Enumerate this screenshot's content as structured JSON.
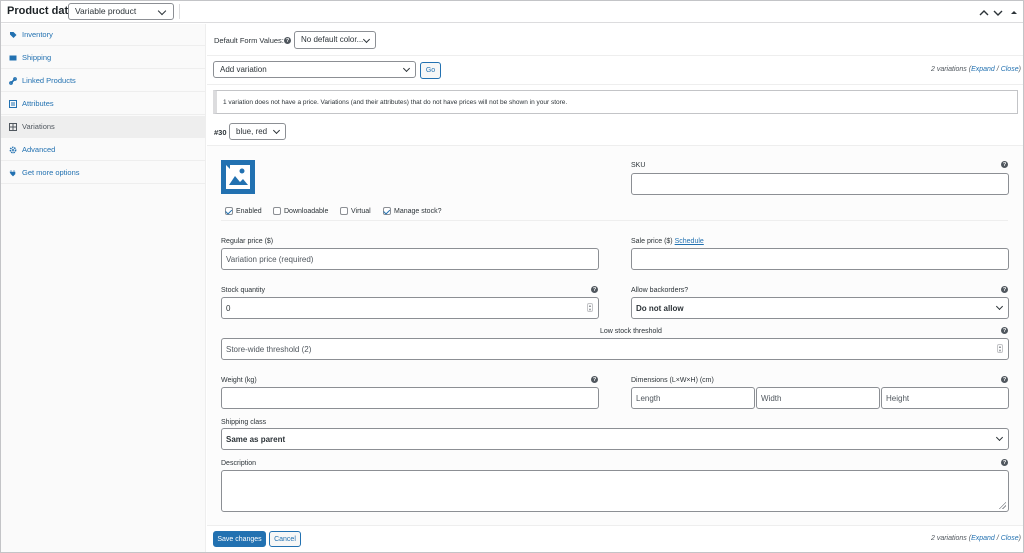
{
  "header": {
    "title": "Product data —",
    "product_type": "Variable product",
    "icons": [
      "chevron-up-icon",
      "chevron-down-icon",
      "collapse-toggle-icon"
    ]
  },
  "sidebar": {
    "items": [
      {
        "label": "Inventory",
        "icon": "inventory-tag-icon"
      },
      {
        "label": "Shipping",
        "icon": "shipping-truck-icon"
      },
      {
        "label": "Linked Products",
        "icon": "link-icon"
      },
      {
        "label": "Attributes",
        "icon": "attributes-list-icon"
      },
      {
        "label": "Variations",
        "icon": "variations-grid-icon"
      },
      {
        "label": "Advanced",
        "icon": "gear-icon"
      },
      {
        "label": "Get more options",
        "icon": "plugin-icon"
      }
    ]
  },
  "defaults": {
    "label": "Default Form Values:",
    "select": "No default color..."
  },
  "toolbar": {
    "action_select": "Add variation",
    "go": "Go",
    "count": "2 variations",
    "expand": "Expand",
    "sep": "/",
    "close": "Close"
  },
  "notice": "1 variation does not have a price. Variations (and their attributes) that do not have prices will not be shown in your store.",
  "variation": {
    "id": "#30",
    "attributes": "blue, red",
    "sku_label": "SKU",
    "sku_value": "",
    "checks": {
      "enabled": "Enabled",
      "downloadable": "Downloadable",
      "virtual": "Virtual",
      "manage_stock": "Manage stock?"
    },
    "checked": {
      "enabled": true,
      "downloadable": false,
      "virtual": false,
      "manage_stock": true
    },
    "regular_price_label": "Regular price ($)",
    "regular_price_placeholder": "Variation price (required)",
    "sale_price_label": "Sale price ($)",
    "schedule": "Schedule",
    "stock_qty_label": "Stock quantity",
    "stock_qty_value": "0",
    "backorders_label": "Allow backorders?",
    "backorders_value": "Do not allow",
    "low_stock_label": "Low stock threshold",
    "low_stock_placeholder": "Store-wide threshold (2)",
    "weight_label": "Weight (kg)",
    "dimensions_label": "Dimensions (L×W×H) (cm)",
    "length_placeholder": "Length",
    "width_placeholder": "Width",
    "height_placeholder": "Height",
    "shipping_class_label": "Shipping class",
    "shipping_class_value": "Same as parent",
    "description_label": "Description"
  },
  "footer": {
    "save": "Save changes",
    "cancel": "Cancel",
    "count": "2 variations",
    "expand": "Expand",
    "sep": "/",
    "close": "Close"
  },
  "colors": {
    "accent": "#2271b1",
    "border": "#8c8f94",
    "sidebar_bg": "#fafafa",
    "active_bg": "#eeeeee"
  }
}
